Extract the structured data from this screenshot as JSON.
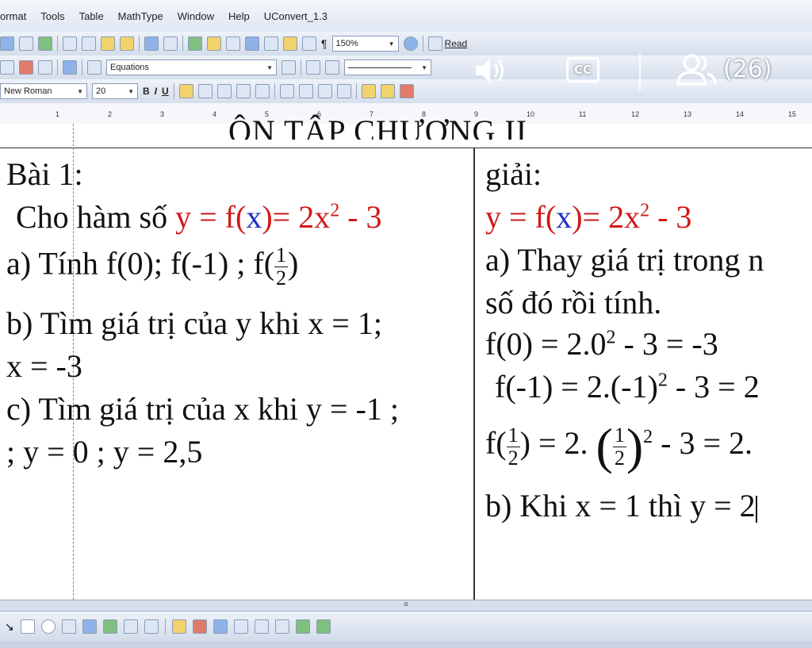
{
  "menu": [
    "ormat",
    "Tools",
    "Table",
    "MathType",
    "Window",
    "Help",
    "UConvert_1.3"
  ],
  "toolbar1": {
    "zoom": "150%",
    "read_label": "Read"
  },
  "toolbar2": {
    "style_combo": "Equations"
  },
  "toolbar3": {
    "font_name": "New Roman",
    "font_size": "20",
    "bold": "B",
    "italic": "I",
    "underline": "U"
  },
  "ruler": [
    "1",
    "2",
    "3",
    "4",
    "5",
    "6",
    "7",
    "8",
    "9",
    "10",
    "11",
    "12",
    "13",
    "14",
    "15"
  ],
  "overlay": {
    "participants": "(26)",
    "cc": "CC"
  },
  "doc": {
    "heading": "ÔN TẬP CHƯƠNG II",
    "left": {
      "title": "Bài 1:",
      "intro": "Cho hàm số",
      "formula_y": "y",
      "formula_eq": " = f(",
      "formula_x": "x",
      "formula_rhs": ")= 2x",
      "formula_sup": "2",
      "formula_tail": " - 3",
      "a_line": "a) Tính f(0); f(-1) ; f(",
      "a_frac_num": "1",
      "a_frac_den": "2",
      "a_close": ")",
      "b_line1": "b) Tìm giá trị của y khi x = 1;",
      "b_line2": "x = -3",
      "c_line1": "c) Tìm giá trị của x khi y = -1 ;",
      "c_line2": "; y = 0 ; y  = 2,5"
    },
    "right": {
      "title": "giải:",
      "formula_y": "y",
      "formula_eq": " = f(",
      "formula_x": "x",
      "formula_rhs": ")= 2x",
      "formula_sup": "2",
      "formula_tail": " - 3",
      "a_line1": "a) Thay giá trị trong n",
      "a_line2": "số đó rồi tính.",
      "f0_main": "f(0) = 2.0",
      "f0_sup": "2",
      "f0_tail": " - 3 = -3",
      "fm1_main": "f(-1) = 2.(-1)",
      "fm1_sup": "2",
      "fm1_tail": " - 3 = 2",
      "fhalf_prefix": "f(",
      "fhalf_mid": ") = 2.",
      "fhalf_sup": "2",
      "fhalf_tail": " - 3 = 2.",
      "frac_num": "1",
      "frac_den": "2",
      "b_line": "b) Khi x = 1 thì y = 2"
    }
  }
}
